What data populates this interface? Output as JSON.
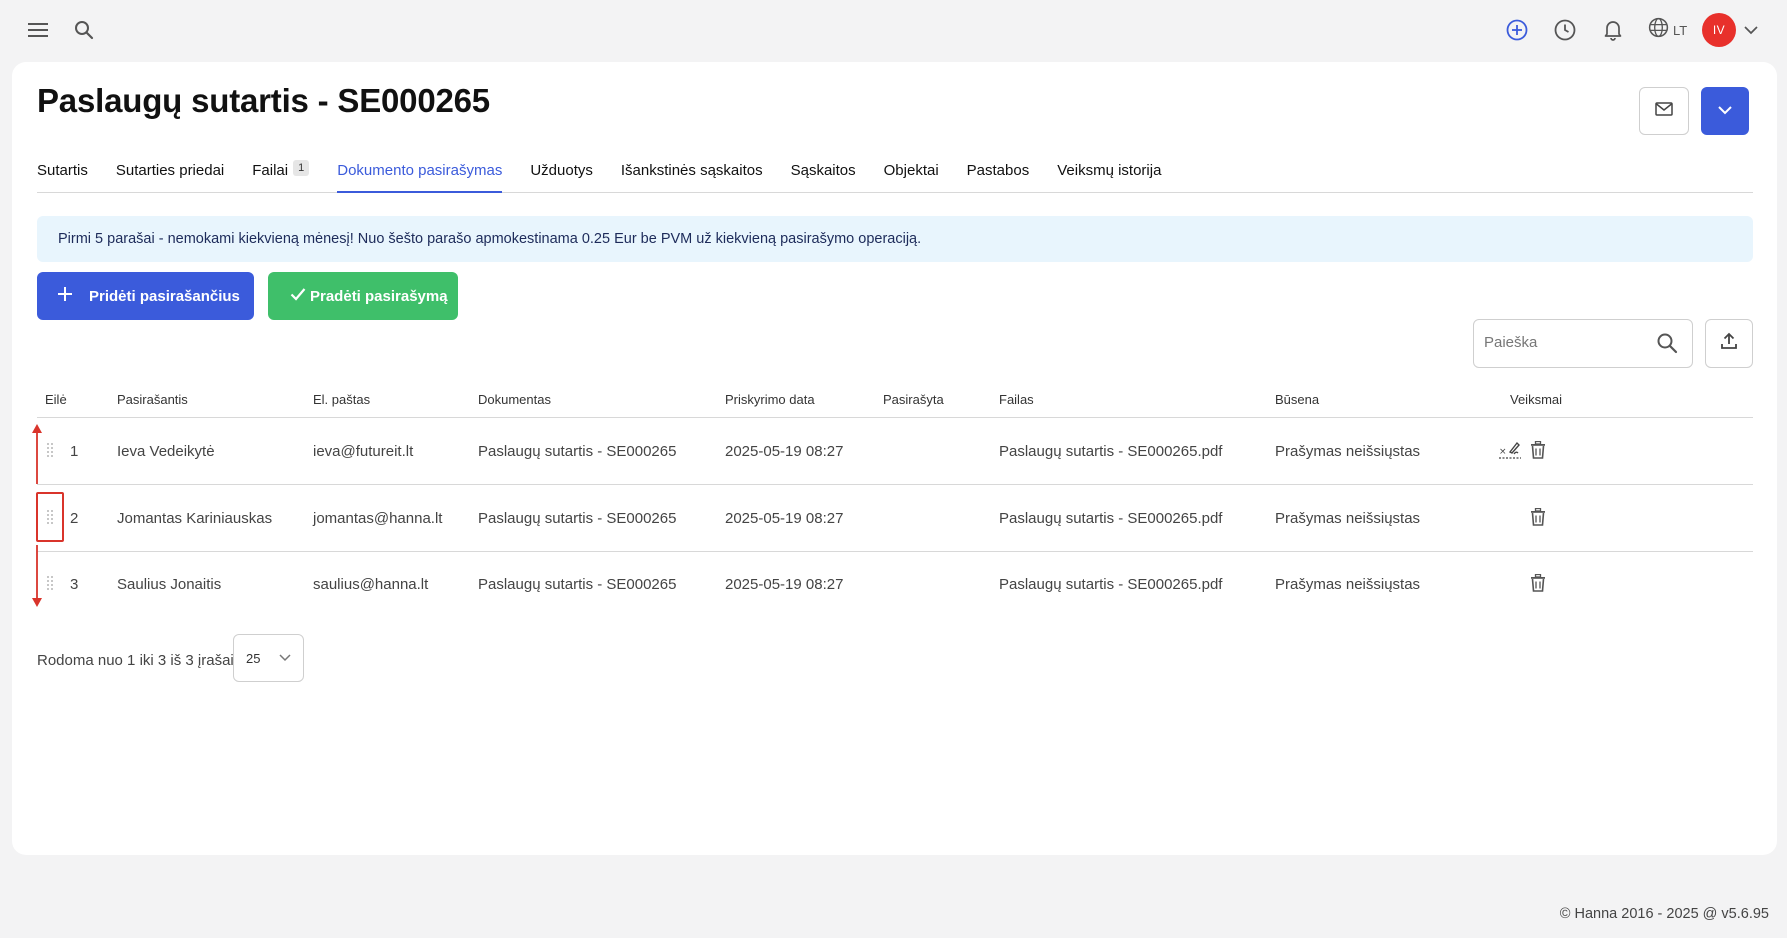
{
  "topbar": {
    "language": "LT",
    "avatar_initials": "IV",
    "accent_color": "#3b5bdb"
  },
  "page": {
    "title": "Paslaugų sutartis - SE000265"
  },
  "tabs": [
    {
      "label": "Sutartis"
    },
    {
      "label": "Sutarties priedai"
    },
    {
      "label": "Failai",
      "badge": "1"
    },
    {
      "label": "Dokumento pasirašymas",
      "active": true
    },
    {
      "label": "Užduotys"
    },
    {
      "label": "Išankstinės sąskaitos"
    },
    {
      "label": "Sąskaitos"
    },
    {
      "label": "Objektai"
    },
    {
      "label": "Pastabos"
    },
    {
      "label": "Veiksmų istorija"
    }
  ],
  "banner": {
    "text": "Pirmi 5 parašai - nemokami kiekvieną mėnesį! Nuo šešto parašo apmokestinama 0.25 Eur be PVM už kiekvieną pasirašymo operaciją."
  },
  "actions": {
    "add_label": "Pridėti pasirašančius",
    "start_label": "Pradėti pasirašymą",
    "add_color": "#3b5bdb",
    "start_color": "#3fbf6a"
  },
  "search": {
    "placeholder": "Paieška"
  },
  "table": {
    "headers": {
      "queue": "Eilė",
      "signer": "Pasirašantis",
      "email": "El. paštas",
      "document": "Dokumentas",
      "assigned": "Priskyrimo data",
      "signed": "Pasirašyta",
      "file": "Failas",
      "status": "Būsena",
      "actions": "Veiksmai"
    },
    "rows": [
      {
        "queue": "1",
        "signer": "Ieva Vedeikytė",
        "email": "ieva@futureit.lt",
        "document": "Paslaugų sutartis - SE000265",
        "assigned": "2025-05-19 08:27",
        "signed": "",
        "file": "Paslaugų sutartis - SE000265.pdf",
        "status": "Prašymas neišsiųstas",
        "has_sign_icon": true
      },
      {
        "queue": "2",
        "signer": "Jomantas Kariniauskas",
        "email": "jomantas@hanna.lt",
        "document": "Paslaugų sutartis - SE000265",
        "assigned": "2025-05-19 08:27",
        "signed": "",
        "file": "Paslaugų sutartis - SE000265.pdf",
        "status": "Prašymas neišsiųstas",
        "has_sign_icon": false
      },
      {
        "queue": "3",
        "signer": "Saulius Jonaitis",
        "email": "saulius@hanna.lt",
        "document": "Paslaugų sutartis - SE000265",
        "assigned": "2025-05-19 08:27",
        "signed": "",
        "file": "Paslaugų sutartis - SE000265.pdf",
        "status": "Prašymas neišsiųstas",
        "has_sign_icon": false
      }
    ]
  },
  "pagination": {
    "summary": "Rodoma nuo 1 iki 3 iš 3 įrašai",
    "page_size": "25"
  },
  "footer": {
    "text": "© Hanna 2016 - 2025 @ v5.6.95"
  }
}
